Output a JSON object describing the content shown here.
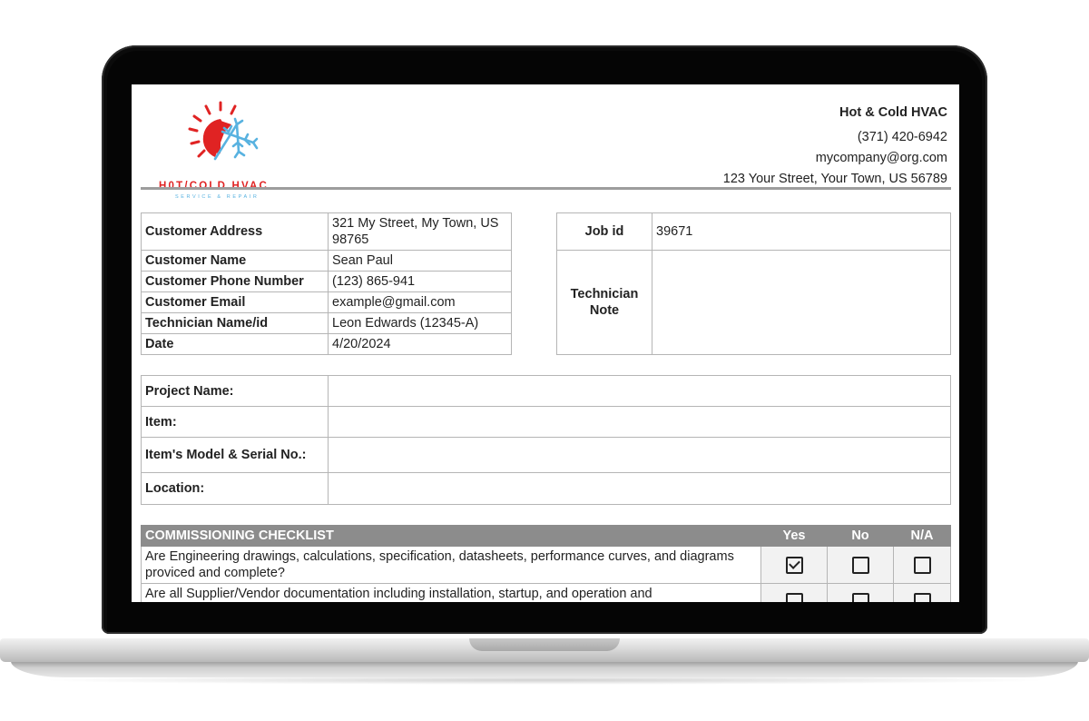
{
  "logo": {
    "title_hot": "H0T",
    "title_cold": "/COLD HVAC",
    "subtitle": "SERVICE & REPAIR",
    "colors": {
      "sun": "#e02323",
      "snow": "#58b2e0"
    }
  },
  "company": {
    "name": "Hot & Cold HVAC",
    "phone": "(371) 420-6942",
    "email": "mycompany@org.com",
    "address": "123 Your Street, Your Town, US 56789"
  },
  "customer": {
    "rows": [
      {
        "label": "Customer Address",
        "value": "321 My Street, My Town, US 98765"
      },
      {
        "label": "Customer Name",
        "value": "Sean Paul"
      },
      {
        "label": "Customer Phone Number",
        "value": "(123) 865-941"
      },
      {
        "label": "Customer Email",
        "value": "example@gmail.com"
      },
      {
        "label": "Technician Name/id",
        "value": "Leon Edwards (12345-A)"
      },
      {
        "label": "Date",
        "value": "4/20/2024"
      }
    ]
  },
  "job": {
    "id_label": "Job id",
    "id_value": "39671",
    "note_label": "Technician Note",
    "note_value": ""
  },
  "project": {
    "rows": [
      {
        "label": "Project Name:",
        "value": ""
      },
      {
        "label": "Item:",
        "value": ""
      },
      {
        "label": "Item's Model & Serial No.:",
        "value": ""
      },
      {
        "label": "Location:",
        "value": ""
      }
    ]
  },
  "checklist": {
    "title": "COMMISSIONING CHECKLIST",
    "columns": [
      "Yes",
      "No",
      "N/A"
    ],
    "items": [
      {
        "question": "Are Engineering drawings, calculations, specification, datasheets, performance curves, and diagrams proviced and complete?",
        "answer": "Yes"
      },
      {
        "question": "Are all Supplier/Vendor documentation including installation, startup, and operation and",
        "answer": ""
      }
    ]
  }
}
